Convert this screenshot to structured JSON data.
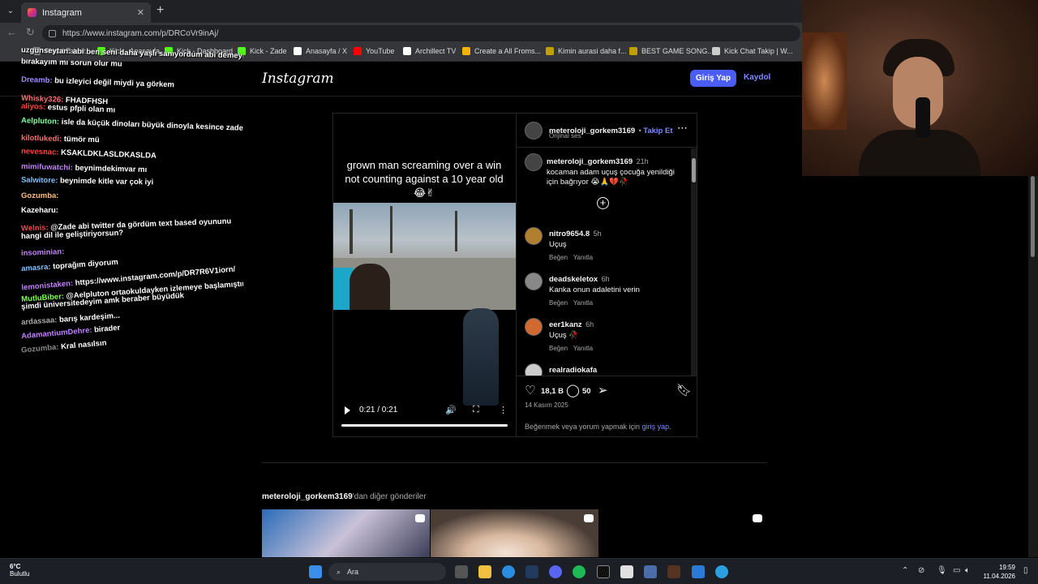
{
  "browser": {
    "tab_title": "Instagram",
    "url": "https://www.instagram.com/p/DRCoVr9inAj/",
    "bookmarks": [
      {
        "label": "Shard Tablet ...",
        "color": "#888888"
      },
      {
        "label": "Kick - Anasayfa",
        "color": "#53fc18"
      },
      {
        "label": "Kick - Dashboard",
        "color": "#53fc18"
      },
      {
        "label": "Kick - Zade",
        "color": "#53fc18"
      },
      {
        "label": "Anasayfa / X",
        "color": "#ffffff"
      },
      {
        "label": "YouTube",
        "color": "#ff0000"
      },
      {
        "label": "Archillect TV",
        "color": "#ffffff"
      },
      {
        "label": "Create a All Froms...",
        "color": "#f4b400"
      },
      {
        "label": "Kimin aurasi daha f...",
        "color": "#c0a000"
      },
      {
        "label": "BEST GAME SONG...",
        "color": "#c0a000"
      },
      {
        "label": "Kick Chat Takip | W...",
        "color": "#cccccc"
      }
    ]
  },
  "header": {
    "logo": "Instagram",
    "login_label": "Giriş Yap",
    "signup_label": "Kaydol"
  },
  "post": {
    "video_caption": "grown man screaming over a win not counting against a 10 year old😂✌",
    "time": "0:21 / 0:21",
    "author": "meteroloji_gorkem3169",
    "follow_label": "Takip Et",
    "audio": "Orijinal ses",
    "caption_author": "meteroloji_gorkem3169",
    "caption_time": "21h",
    "caption_text": "kocaman adam uçuş çocuğa yenildiği için bağrıyor 😭🙏💔🥀",
    "comments": [
      {
        "user": "nitro9654.8",
        "time": "5h",
        "text": "Uçuş",
        "like": "Beğen",
        "reply": "Yanıtla",
        "avatar_color": "#b08030"
      },
      {
        "user": "deadskeletox",
        "time": "6h",
        "text": "Kanka onun adaletini verin",
        "like": "Beğen",
        "reply": "Yanıtla",
        "avatar_color": "#888888"
      },
      {
        "user": "eer1kanz",
        "time": "6h",
        "text": "Uçuş 🥀",
        "like": "Beğen",
        "reply": "Yanıtla",
        "avatar_color": "#d06a30"
      },
      {
        "user": "realradiokafa",
        "time": "",
        "text": "",
        "like": "",
        "reply": "",
        "avatar_color": "#cccccc"
      }
    ],
    "likes": "18,1 B",
    "comments_count": "50",
    "date": "14 Kasım 2025",
    "login_hint": "Beğenmek veya yorum yapmak için",
    "login_link": "giriş yap",
    "login_hint_end": "."
  },
  "more_posts": {
    "author": "meteroloji_gorkem3169",
    "suffix": "'dan diğer gönderiler"
  },
  "chat": [
    {
      "user": "uzgunseytan:",
      "text": "abi ben seni daha yaşlı sanıyordum abi demeyi",
      "color": "#ffffff"
    },
    {
      "user": "",
      "text": "bırakayım mı sorun olur mu",
      "color": "#ffffff"
    },
    {
      "user": "Dreamb:",
      "text": "bu izleyici değil miydi ya görkem",
      "color": "#9d8cff"
    },
    {
      "user": "Whisky326:",
      "text": "FHADFHSH",
      "color": "#ff6f6f"
    },
    {
      "user": "aliyos:",
      "text": "estus pfpli olan mı",
      "color": "#ff4040"
    },
    {
      "user": "Aelpluton:",
      "text": "isle da küçük dinoları büyük dinoyla kesince zade",
      "color": "#7fff9f"
    },
    {
      "user": "kilotlukedi:",
      "text": "tümör mü",
      "color": "#ff6f6f"
    },
    {
      "user": "nevesnac:",
      "text": "KSAKLDKLASLDKASLDA",
      "color": "#ff4040"
    },
    {
      "user": "mimifuwatchi:",
      "text": "beynimdekimvar mı",
      "color": "#c080ff"
    },
    {
      "user": "Salwitore:",
      "text": "beynimde kitle var çok iyi",
      "color": "#80c0ff"
    },
    {
      "user": "Gozumba:",
      "text": "",
      "color": "#ffc080"
    },
    {
      "user": "Kazeharu:",
      "text": "",
      "color": "#ffffff"
    },
    {
      "user": "Welnis:",
      "text": "@Zade abi twitter da gördüm text based oyununu",
      "color": "#ff4040"
    },
    {
      "user": "",
      "text": "hangi dil ile geliştiriyorsun?",
      "color": "#ffffff"
    },
    {
      "user": "insominian:",
      "text": "",
      "color": "#c080ff"
    },
    {
      "user": "amasra:",
      "text": "toprağım diyorum",
      "color": "#80c0ff"
    },
    {
      "user": "lemonistaken:",
      "text": "https://www.instagram.com/p/DR7R6V1iorn/",
      "color": "#c080ff"
    },
    {
      "user": "MutluBiber:",
      "text": "@Aelpluton ortaokuldayken izlemeye başlamıştım",
      "color": "#7fff4f"
    },
    {
      "user": "",
      "text": "şimdi üniversitedeyim amk beraber büyüdük",
      "color": "#ffffff"
    },
    {
      "user": "ardassaa:",
      "text": "barış kardeşim...",
      "color": "#aaaaaa"
    },
    {
      "user": "AdamantiumDehre:",
      "text": "birader",
      "color": "#c080ff"
    },
    {
      "user": "Gozumba:",
      "text": "Kral nasılsın",
      "color": "#888888"
    }
  ],
  "taskbar": {
    "temp": "6°C",
    "weather": "Bulutlu",
    "search": "Ara",
    "time": "19:59",
    "date": "11.04.2026"
  },
  "colors": {
    "accent": "#4a5df9",
    "link": "#7c8cff",
    "background": "#000000"
  }
}
